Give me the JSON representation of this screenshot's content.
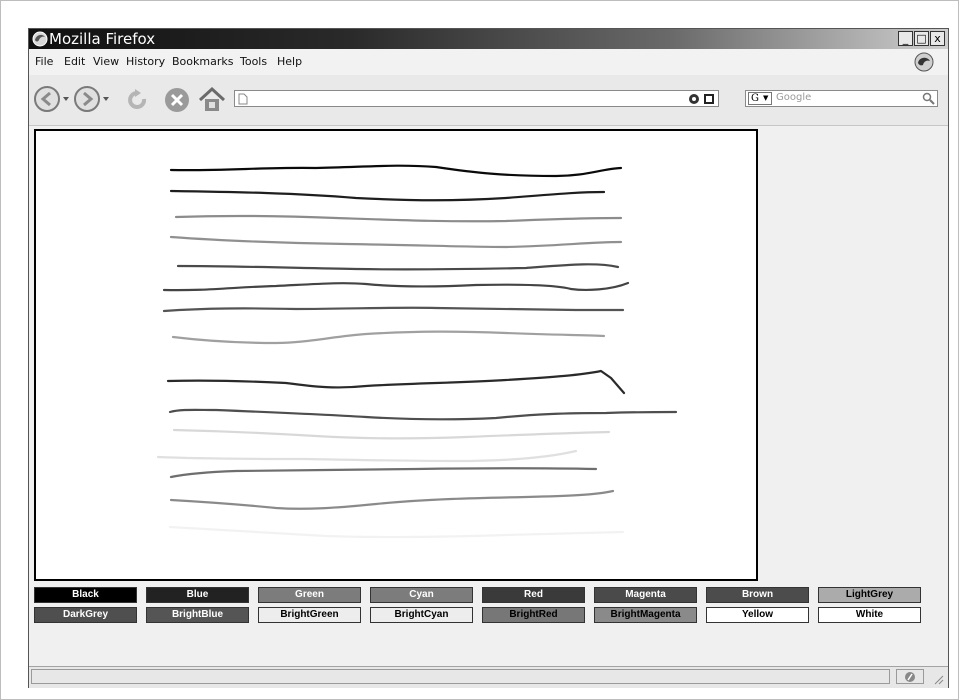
{
  "window": {
    "title": "Mozilla Firefox",
    "controls": {
      "minimize": "_",
      "maximize": "□",
      "close": "x"
    }
  },
  "menu": {
    "items": [
      "File",
      "Edit",
      "View",
      "History",
      "Bookmarks",
      "Tools",
      "Help"
    ]
  },
  "toolbar": {
    "icons": [
      "back-icon",
      "back-dropdown-icon",
      "forward-icon",
      "forward-dropdown-icon",
      "reload-icon",
      "stop-icon",
      "home-icon",
      "page-icon",
      "go-icon",
      "rss-icon",
      "search-engine-icon",
      "search-icon"
    ],
    "url": "",
    "search_engine_letter": "G",
    "search_placeholder": "Google"
  },
  "canvas": {
    "strokes": [
      {
        "color": "#0a0a0a"
      },
      {
        "color": "#1e1e1e"
      },
      {
        "color": "#8c8c8c"
      },
      {
        "color": "#909090"
      },
      {
        "color": "#4a4a4a"
      },
      {
        "color": "#444444"
      },
      {
        "color": "#545454"
      },
      {
        "color": "#a0a0a0"
      },
      {
        "color": "#2a2a2a"
      },
      {
        "color": "#4e4e4e"
      },
      {
        "color": "#d8d8d8"
      },
      {
        "color": "#e0e0e0"
      },
      {
        "color": "#6e6e6e"
      },
      {
        "color": "#8a8a8a"
      },
      {
        "color": "#f2f2f2"
      }
    ]
  },
  "palette": [
    {
      "label": "Black",
      "bg": "#000000",
      "fg": "#ffffff"
    },
    {
      "label": "Blue",
      "bg": "#222222",
      "fg": "#ffffff"
    },
    {
      "label": "Green",
      "bg": "#7c7c7c",
      "fg": "#ffffff"
    },
    {
      "label": "Cyan",
      "bg": "#7c7c7c",
      "fg": "#ffffff"
    },
    {
      "label": "Red",
      "bg": "#3a3a3a",
      "fg": "#ffffff"
    },
    {
      "label": "Magenta",
      "bg": "#4a4a4a",
      "fg": "#ffffff"
    },
    {
      "label": "Brown",
      "bg": "#4c4c4c",
      "fg": "#ffffff"
    },
    {
      "label": "LightGrey",
      "bg": "#ababab",
      "fg": "#000000"
    },
    {
      "label": "DarkGrey",
      "bg": "#4f4f4f",
      "fg": "#ffffff"
    },
    {
      "label": "BrightBlue",
      "bg": "#555555",
      "fg": "#ffffff"
    },
    {
      "label": "BrightGreen",
      "bg": "#ededed",
      "fg": "#000000"
    },
    {
      "label": "BrightCyan",
      "bg": "#ededed",
      "fg": "#000000"
    },
    {
      "label": "BrightRed",
      "bg": "#777777",
      "fg": "#000000"
    },
    {
      "label": "BrightMagenta",
      "bg": "#8a8a8a",
      "fg": "#000000"
    },
    {
      "label": "Yellow",
      "bg": "#ffffff",
      "fg": "#000000"
    },
    {
      "label": "White",
      "bg": "#ffffff",
      "fg": "#000000"
    }
  ],
  "statusbar": {
    "text": "",
    "icons": [
      "status-icon",
      "resize-grip-icon"
    ]
  }
}
